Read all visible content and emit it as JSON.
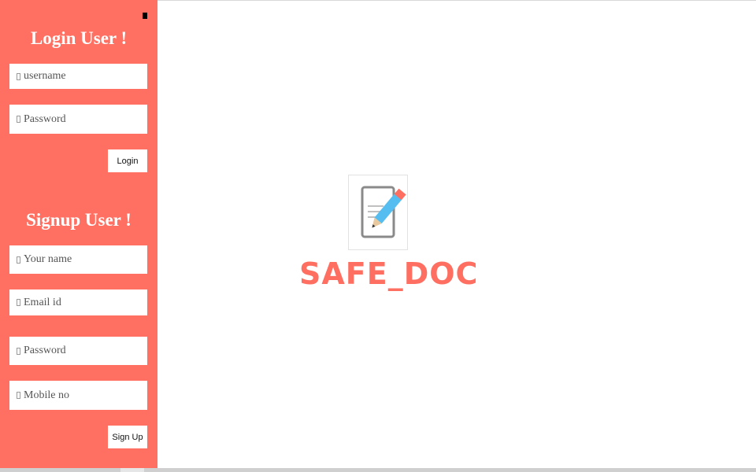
{
  "login": {
    "heading": "Login User !",
    "username_placeholder": "username",
    "password_placeholder": "Password",
    "button_label": "Login"
  },
  "signup": {
    "heading": "Signup User !",
    "name_placeholder": "Your name",
    "email_placeholder": "Email id",
    "password_placeholder": "Password",
    "mobile_placeholder": "Mobile no",
    "button_label": "Sign Up"
  },
  "brand": {
    "name": "SAFE_DOC",
    "icon": "document-pencil-icon"
  },
  "colors": {
    "sidebar": "#ff7062",
    "brand_text": "#ff6f61"
  }
}
